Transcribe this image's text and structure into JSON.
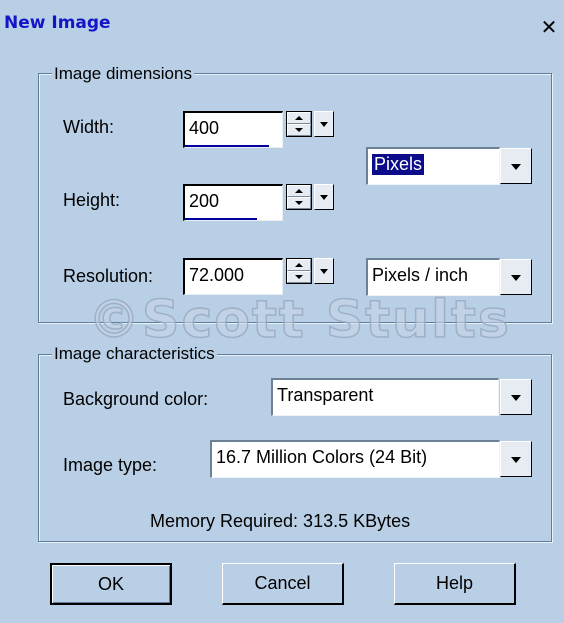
{
  "dialog": {
    "title": "New Image",
    "close_label": "✕"
  },
  "dimensions": {
    "group_label": "Image dimensions",
    "width_label": "Width:",
    "width_value": "400",
    "height_label": "Height:",
    "height_value": "200",
    "resolution_label": "Resolution:",
    "resolution_value": "72.000",
    "unit_selected": "Pixels",
    "resolution_unit_selected": "Pixels / inch"
  },
  "characteristics": {
    "group_label": "Image characteristics",
    "bg_color_label": "Background color:",
    "bg_color_value": "Transparent",
    "image_type_label": "Image type:",
    "image_type_value": "16.7 Million Colors (24 Bit)",
    "memory_text": "Memory Required: 313.5 KBytes"
  },
  "buttons": {
    "ok": "OK",
    "cancel": "Cancel",
    "help": "Help"
  },
  "watermark": "©Scott Stults",
  "colors": {
    "dialog_bg": "#b8cfe6",
    "title_text": "#1515c8",
    "frame": "#0000b8",
    "selection": "#0c0c8a"
  }
}
